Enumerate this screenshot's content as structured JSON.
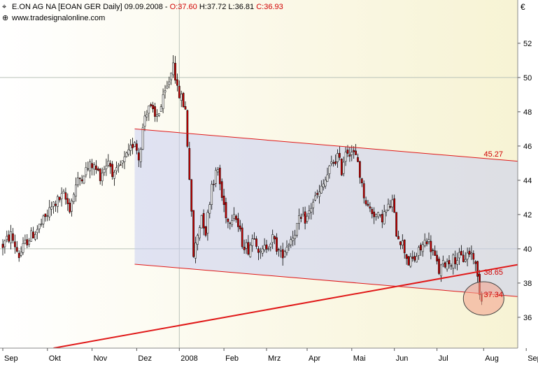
{
  "header": {
    "symbol_text": "E.ON AG NA [EOAN GER  Daily] 09.09.2008 -",
    "ohlc": [
      {
        "label": "O:",
        "value": "37.60"
      },
      {
        "label": "H:",
        "value": "37.72"
      },
      {
        "label": "L:",
        "value": "36.81"
      },
      {
        "label": "C:",
        "value": "36.93"
      }
    ],
    "source": "www.tradesignalonline.com",
    "currency": "€"
  },
  "colors": {
    "chart_bg_left": "#ffffff",
    "chart_bg_right": "#f7f3d4",
    "channel_fill": "#c9cdf1",
    "channel_line": "#e01818",
    "candle_up": "#ffffff",
    "candle_down": "#c80000",
    "wick": "#000000",
    "axis_text": "#000000",
    "grid": "#b9c2b9"
  },
  "chart_data": {
    "type": "candlestick",
    "title": "E.ON AG NA [EOAN GER  Daily] 09.09.2008",
    "xlabel": "",
    "ylabel": "€",
    "ylim": [
      34.2,
      53.2
    ],
    "y_ticks": [
      36,
      38,
      40,
      42,
      44,
      46,
      48,
      50,
      52
    ],
    "x_ticks": [
      "Sep",
      "Okt",
      "Nov",
      "Dez",
      "2008",
      "Feb",
      "Mrz",
      "Apr",
      "Mai",
      "Jun",
      "Jul",
      "Aug",
      "Sep"
    ],
    "grid_y": [
      40,
      50
    ],
    "grid_x": [
      "2008"
    ],
    "series_path": [
      [
        0,
        40.2
      ],
      [
        4,
        40.8
      ],
      [
        8,
        39.6
      ],
      [
        12,
        40.5
      ],
      [
        16,
        41.0
      ],
      [
        20,
        41.6
      ],
      [
        25,
        42.6
      ],
      [
        30,
        43.1
      ],
      [
        33,
        42.4
      ],
      [
        36,
        43.7
      ],
      [
        40,
        44.5
      ],
      [
        44,
        44.9
      ],
      [
        48,
        44.3
      ],
      [
        52,
        45.2
      ],
      [
        55,
        44.2
      ],
      [
        58,
        44.8
      ],
      [
        62,
        45.5
      ],
      [
        65,
        46.4
      ],
      [
        67,
        45.3
      ],
      [
        70,
        47.8
      ],
      [
        72,
        48.4
      ],
      [
        75,
        47.6
      ],
      [
        78,
        48.3
      ],
      [
        81,
        49.4
      ],
      [
        83,
        50.3
      ],
      [
        84,
        51.1
      ],
      [
        86,
        49.2
      ],
      [
        88,
        48.8
      ],
      [
        90,
        48.1
      ],
      [
        92,
        44.2
      ],
      [
        94,
        39.6
      ],
      [
        96,
        40.8
      ],
      [
        98,
        42.0
      ],
      [
        100,
        41.0
      ],
      [
        103,
        43.8
      ],
      [
        106,
        44.6
      ],
      [
        108,
        43.0
      ],
      [
        111,
        41.6
      ],
      [
        114,
        42.2
      ],
      [
        118,
        40.4
      ],
      [
        121,
        40.0
      ],
      [
        124,
        40.9
      ],
      [
        127,
        39.6
      ],
      [
        130,
        40.2
      ],
      [
        133,
        40.6
      ],
      [
        137,
        39.6
      ],
      [
        140,
        40.2
      ],
      [
        143,
        40.8
      ],
      [
        146,
        41.6
      ],
      [
        150,
        41.8
      ],
      [
        153,
        42.8
      ],
      [
        156,
        43.2
      ],
      [
        159,
        44.0
      ],
      [
        162,
        44.9
      ],
      [
        165,
        45.4
      ],
      [
        167,
        44.6
      ],
      [
        169,
        45.8
      ],
      [
        172,
        45.7
      ],
      [
        175,
        45.1
      ],
      [
        177,
        43.6
      ],
      [
        180,
        42.4
      ],
      [
        183,
        42.1
      ],
      [
        186,
        41.7
      ],
      [
        189,
        42.2
      ],
      [
        192,
        42.7
      ],
      [
        194,
        41.0
      ],
      [
        197,
        40.3
      ],
      [
        200,
        39.2
      ],
      [
        203,
        39.4
      ],
      [
        206,
        40.0
      ],
      [
        209,
        40.6
      ],
      [
        212,
        39.8
      ],
      [
        215,
        38.7
      ],
      [
        218,
        39.2
      ],
      [
        221,
        39.3
      ],
      [
        224,
        39.5
      ],
      [
        227,
        39.4
      ],
      [
        230,
        39.8
      ],
      [
        232,
        39.6
      ],
      [
        234,
        38.3
      ],
      [
        235,
        37.6
      ],
      [
        236,
        36.93
      ]
    ],
    "channel": {
      "upper": [
        [
          65,
          47.0
        ],
        [
          255,
          45.1
        ]
      ],
      "lower": [
        [
          65,
          39.1
        ],
        [
          255,
          37.2
        ]
      ],
      "label_upper": "45.27"
    },
    "trendline": {
      "points": [
        [
          25,
          34.2
        ],
        [
          255,
          39.1
        ]
      ],
      "label": "38.65"
    },
    "last_value_label": "37.34",
    "highlight_circle": {
      "x": 237,
      "y": 37.1
    },
    "legend": "none"
  }
}
